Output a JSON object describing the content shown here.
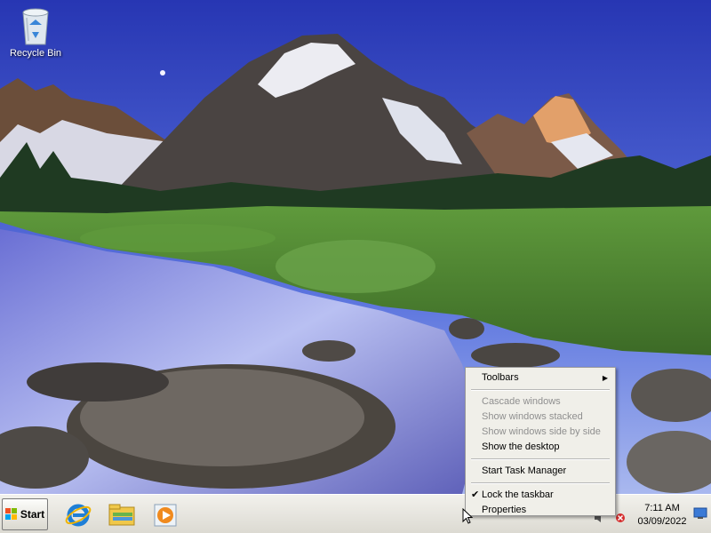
{
  "desktop": {
    "icons": [
      {
        "label": "Recycle Bin",
        "icon": "recycle-bin-icon"
      }
    ]
  },
  "context_menu": {
    "items": [
      {
        "label": "Toolbars",
        "disabled": false,
        "submenu": true
      },
      {
        "label": "Cascade windows",
        "disabled": true
      },
      {
        "label": "Show windows stacked",
        "disabled": true
      },
      {
        "label": "Show windows side by side",
        "disabled": true
      },
      {
        "label": "Show the desktop",
        "disabled": false
      },
      {
        "label": "Start Task Manager",
        "disabled": false
      },
      {
        "label": "Lock the taskbar",
        "disabled": false,
        "checked": true
      },
      {
        "label": "Properties",
        "disabled": false
      }
    ]
  },
  "taskbar": {
    "start_label": "Start",
    "quick_launch": [
      "internet-explorer-icon",
      "file-explorer-icon",
      "media-player-icon"
    ],
    "tray_icons": [
      "network-icon",
      "volume-icon",
      "error-icon"
    ],
    "clock": {
      "time": "7:11 AM",
      "date": "03/09/2022"
    }
  },
  "colors": {
    "sky": "#2d3fb9",
    "grass": "#4f7a34",
    "menu_bg": "#f0efe9",
    "taskbar_bg": "#e6e4dc"
  }
}
